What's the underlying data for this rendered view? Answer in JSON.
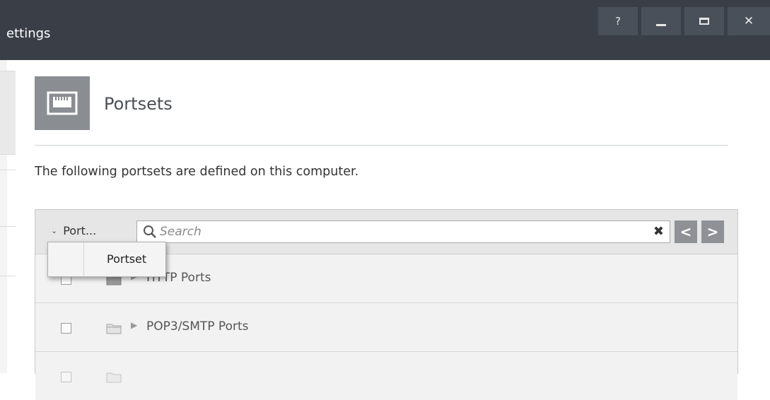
{
  "window": {
    "title": "ettings",
    "help_label": "?",
    "close_label": "✕"
  },
  "header": {
    "title": "Portsets",
    "description": "The following portsets are defined on this computer."
  },
  "toolbar": {
    "column_selector_label": "Port...",
    "search_placeholder": "Search",
    "prev_label": "<",
    "next_label": ">"
  },
  "column_popup": {
    "options": [
      {
        "label": "Portset",
        "checked": false
      }
    ]
  },
  "portsets": [
    {
      "name": "HTTP Ports"
    },
    {
      "name": "POP3/SMTP Ports"
    }
  ],
  "colors": {
    "titlebar": "#3a3f47",
    "icon_tile": "#8a8d92",
    "nav_button": "#8e9196"
  },
  "icons": [
    "help-icon",
    "minimize-icon",
    "maximize-icon",
    "close-icon",
    "network-port-icon",
    "chevron-down-icon",
    "search-icon",
    "clear-icon",
    "chevron-left-icon",
    "chevron-right-icon",
    "folder-icon",
    "expand-arrow-icon"
  ]
}
